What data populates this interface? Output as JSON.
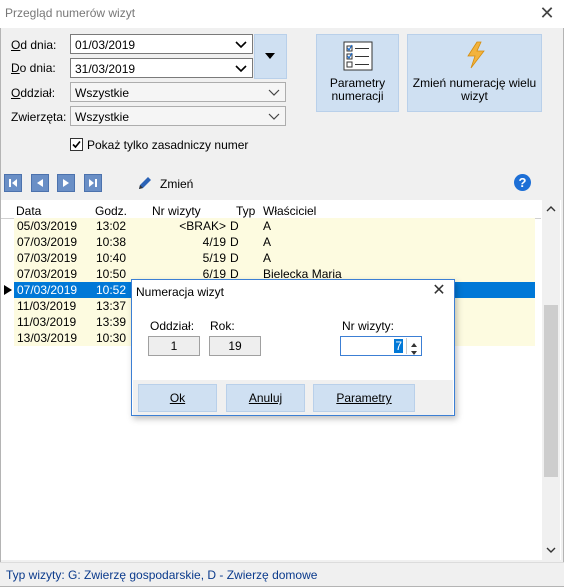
{
  "window": {
    "title": "Przegląd numerów wizyt"
  },
  "filters": {
    "od_dnia_label": "Od dnia:",
    "od_dnia_value": "01/03/2019",
    "do_dnia_label": "Do dnia:",
    "do_dnia_value": "31/03/2019",
    "oddzial_label": "Oddział:",
    "oddzial_value": "Wszystkie",
    "zwierzeta_label": "Zwierzęta:",
    "zwierzeta_value": "Wszystkie",
    "checkbox_label": "Pokaż tylko zasadniczy numer",
    "checkbox_checked": true
  },
  "buttons": {
    "parametry_line1": "Parametry",
    "parametry_line2": "numeracji",
    "zmien_numeracje_line1": "Zmień numerację wielu",
    "zmien_numeracje_line2": "wizyt"
  },
  "toolbar": {
    "zmien_label": "Zmień"
  },
  "table": {
    "headers": [
      "Data",
      "Godz.",
      "Nr wizyty",
      "Typ",
      "Właściciel"
    ],
    "rows": [
      {
        "date": "05/03/2019",
        "time": "13:02",
        "nr": "<BRAK>",
        "typ": "D",
        "owner": "A"
      },
      {
        "date": "07/03/2019",
        "time": "10:38",
        "nr": "4/19",
        "typ": "D",
        "owner": "A"
      },
      {
        "date": "07/03/2019",
        "time": "10:40",
        "nr": "5/19",
        "typ": "D",
        "owner": "A"
      },
      {
        "date": "07/03/2019",
        "time": "10:50",
        "nr": "6/19",
        "typ": "D",
        "owner": "Bielecka Maria"
      },
      {
        "date": "07/03/2019",
        "time": "10:52",
        "nr": "",
        "typ": "",
        "owner": ""
      },
      {
        "date": "11/03/2019",
        "time": "13:37",
        "nr": "",
        "typ": "",
        "owner": ""
      },
      {
        "date": "11/03/2019",
        "time": "13:39",
        "nr": "",
        "typ": "",
        "owner": ""
      },
      {
        "date": "13/03/2019",
        "time": "10:30",
        "nr": "",
        "typ": "",
        "owner": ""
      }
    ],
    "selected_row": 4
  },
  "status": {
    "text": "Typ wizyty:  G: Zwierzę gospodarskie, D - Zwierzę domowe"
  },
  "dialog": {
    "title": "Numeracja wizyt",
    "oddzial_label": "Oddział:",
    "oddzial_value": "1",
    "rok_label": "Rok:",
    "rok_value": "19",
    "nr_label": "Nr wizyty:",
    "nr_value": "7",
    "ok_label": "Ok",
    "anuluj_label": "Anuluj",
    "parametry_label": "Parametry"
  },
  "colors": {
    "accent": "#0078d7",
    "button": "#cfe0f2",
    "row": "#fdfbe0",
    "status_text": "#0a3a8c"
  }
}
